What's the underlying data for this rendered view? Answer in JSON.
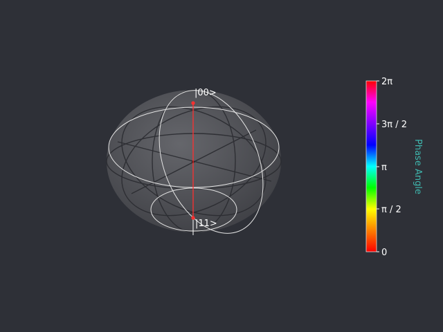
{
  "sphere": {
    "top_state_label": "|00>",
    "bottom_state_label": "|11>",
    "vector_color": "#ff3030",
    "sphere_fill": "#5a5b5f",
    "wire_color": "#e6e6e6"
  },
  "colorbar": {
    "title": "Phase Angle",
    "title_color": "#3fb6ad",
    "ticks": [
      "2π",
      "3π / 2",
      "π",
      "π / 2",
      "0"
    ],
    "gradient_stops": [
      "#ff0000",
      "#ff8000",
      "#ffff00",
      "#00ff00",
      "#00ffff",
      "#0000ff",
      "#8000ff",
      "#ff00ff",
      "#ff0000"
    ]
  },
  "theme": {
    "background": "#2e3037"
  }
}
